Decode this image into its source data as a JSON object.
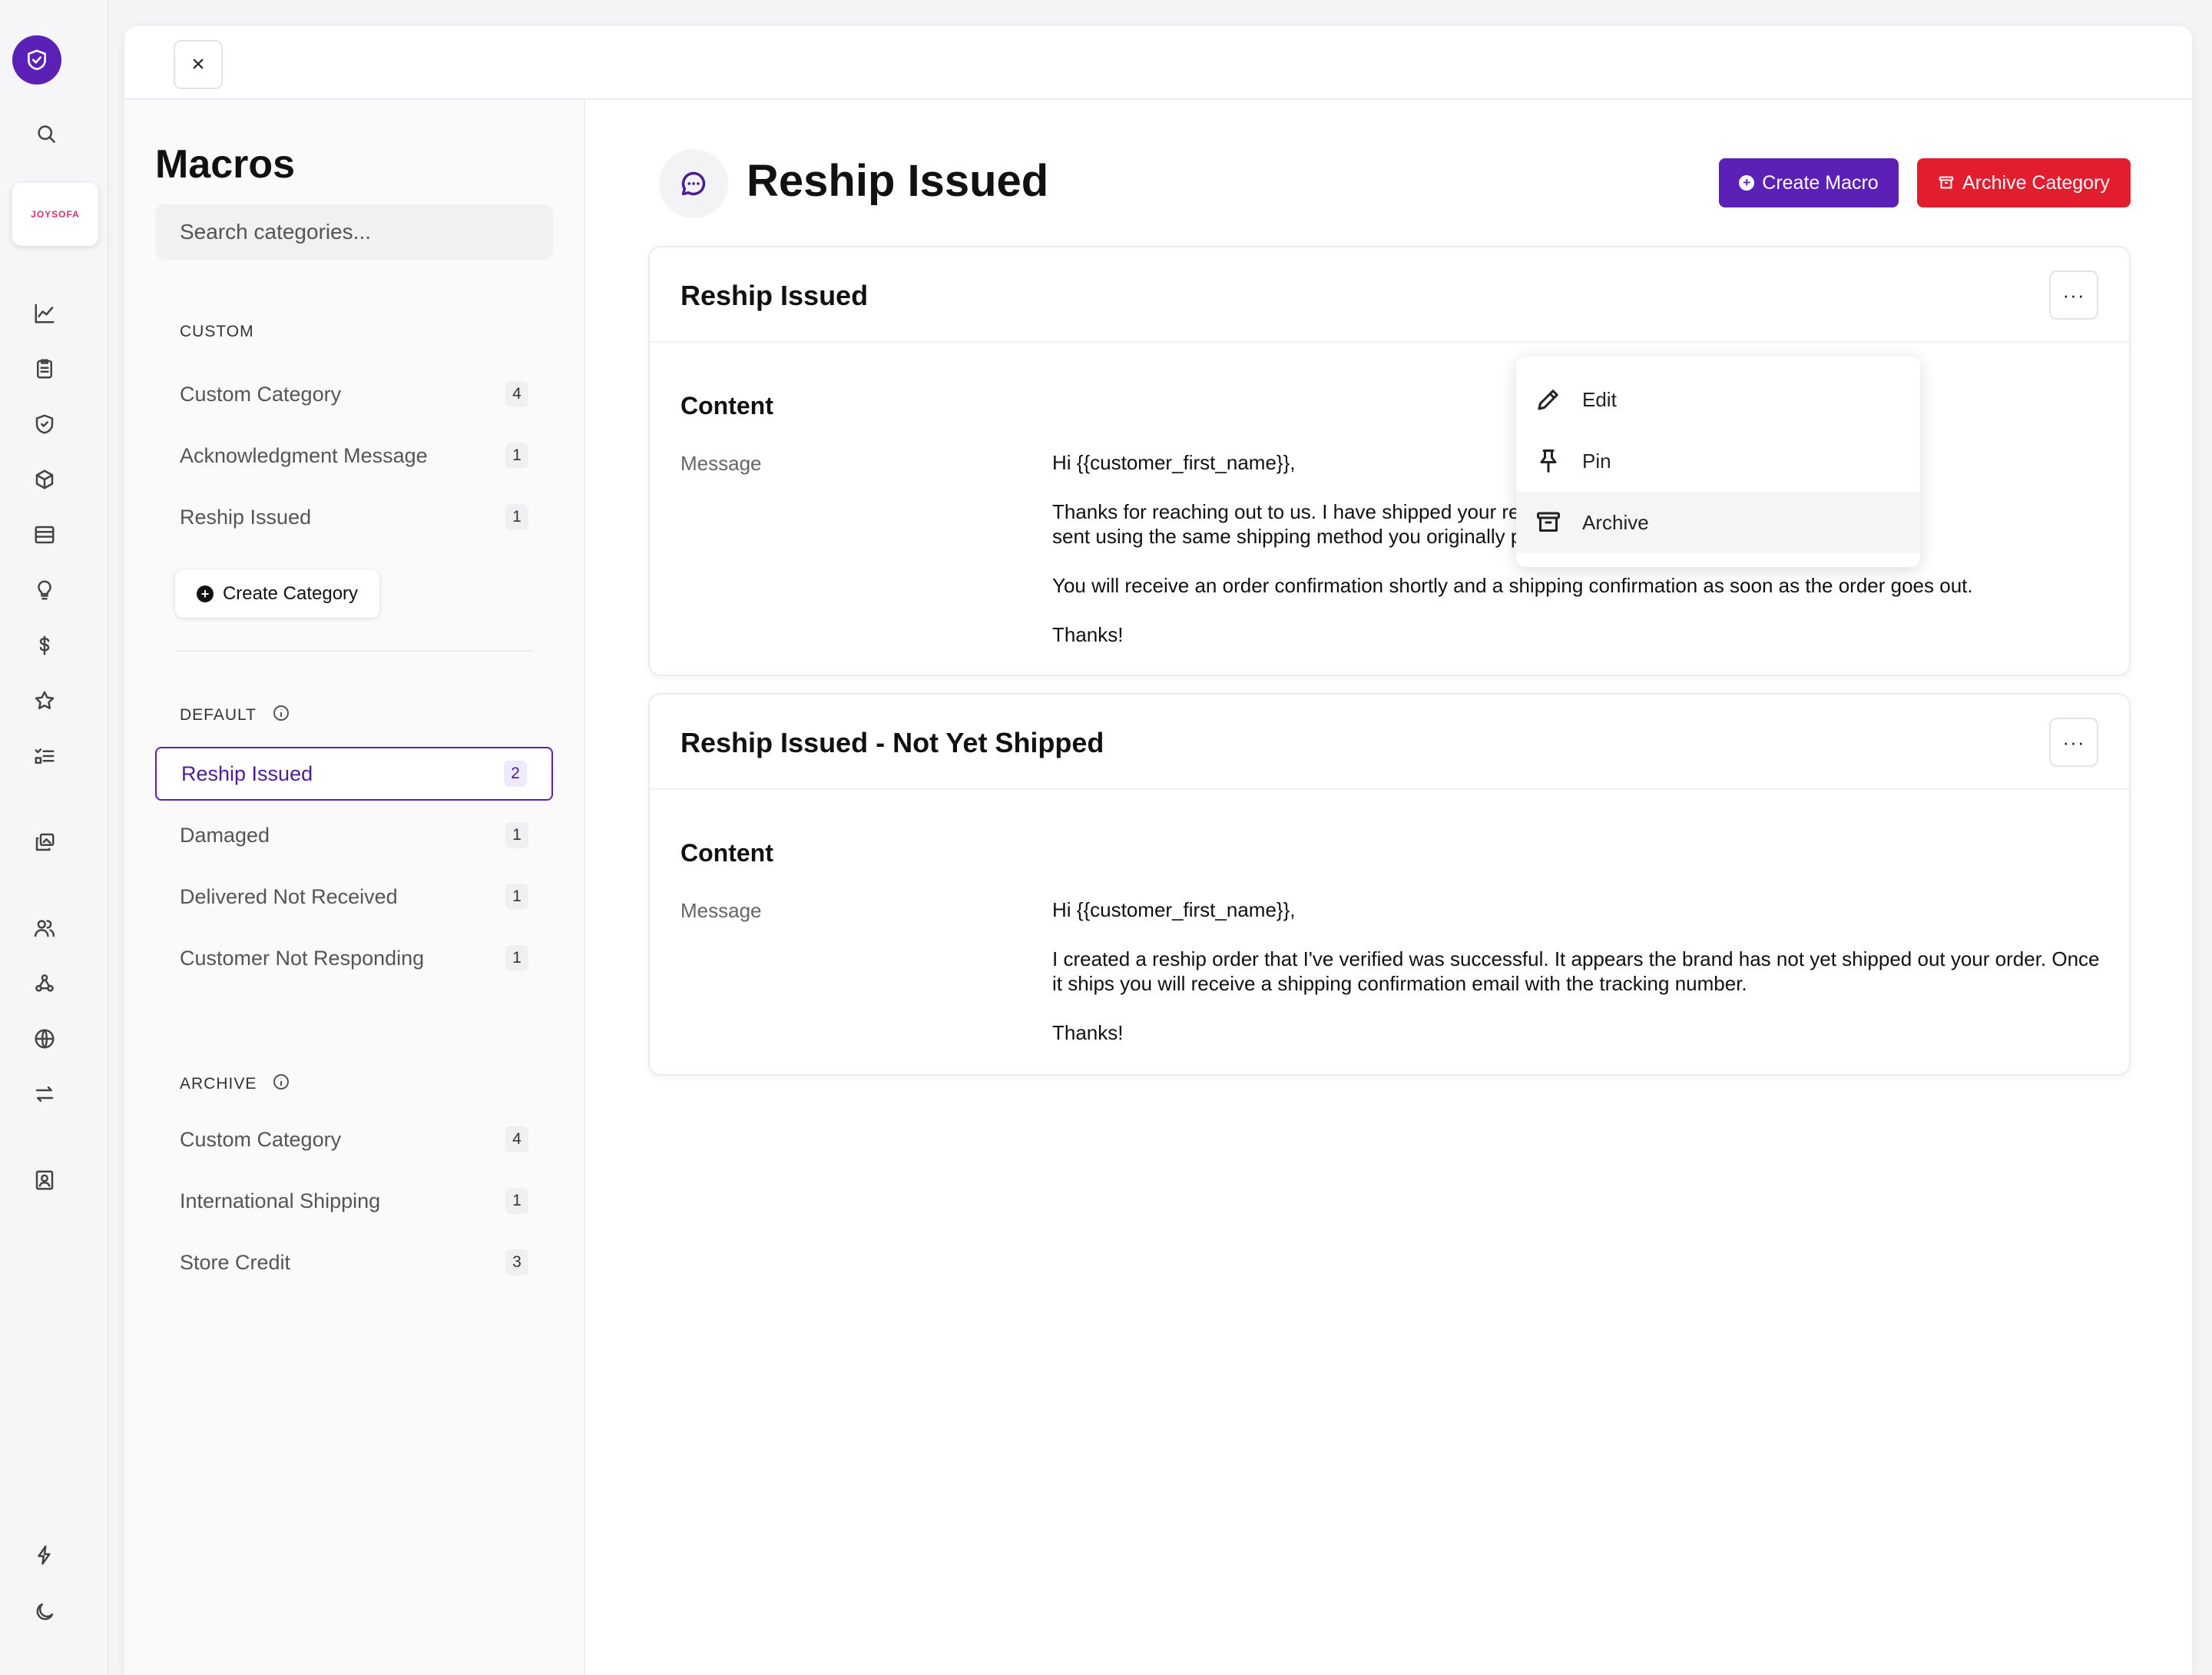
{
  "rail": {
    "brand_label": "JOYSOFA"
  },
  "panel": {
    "close_label": "×"
  },
  "sidebar": {
    "title": "Macros",
    "search_placeholder": "Search categories...",
    "custom_label": "CUSTOM",
    "custom_items": [
      {
        "label": "Custom Category",
        "count": "4"
      },
      {
        "label": "Acknowledgment Message",
        "count": "1"
      },
      {
        "label": "Reship Issued",
        "count": "1"
      }
    ],
    "create_category_label": "Create Category",
    "default_label": "DEFAULT",
    "default_items": [
      {
        "label": "Reship Issued",
        "count": "2",
        "active": true
      },
      {
        "label": "Damaged",
        "count": "1"
      },
      {
        "label": "Delivered Not Received",
        "count": "1"
      },
      {
        "label": "Customer Not Responding",
        "count": "1"
      }
    ],
    "archive_label": "ARCHIVE",
    "archive_items": [
      {
        "label": "Custom Category",
        "count": "4"
      },
      {
        "label": "International Shipping",
        "count": "1"
      },
      {
        "label": "Store Credit",
        "count": "3"
      }
    ]
  },
  "main": {
    "title": "Reship Issued",
    "create_macro_label": "Create Macro",
    "archive_category_label": "Archive Category",
    "more_label": "···",
    "macros": [
      {
        "title": "Reship Issued",
        "content_label": "Content",
        "message_label": "Message",
        "paragraphs": [
          "Hi {{customer_first_name}},",
          "Thanks for reaching out to us. I have shipped your replacement order sent using the same shipping method you originally purchased.",
          "You will receive an order confirmation shortly and a shipping confirmation as soon as the order goes out.",
          "Thanks!"
        ]
      },
      {
        "title": "Reship Issued - Not Yet Shipped",
        "content_label": "Content",
        "message_label": "Message",
        "paragraphs": [
          "Hi {{customer_first_name}},",
          "I created a reship order that I've verified was successful. It appears the brand has not yet shipped out your order. Once it ships you will receive a shipping confirmation email with the tracking number.",
          "Thanks!"
        ]
      }
    ],
    "dropdown": {
      "items": [
        {
          "label": "Edit",
          "icon": "pencil-icon"
        },
        {
          "label": "Pin",
          "icon": "pin-icon"
        },
        {
          "label": "Archive",
          "icon": "archive-icon"
        }
      ]
    }
  },
  "colors": {
    "accent": "#5b21b6",
    "danger": "#e11d2e"
  }
}
